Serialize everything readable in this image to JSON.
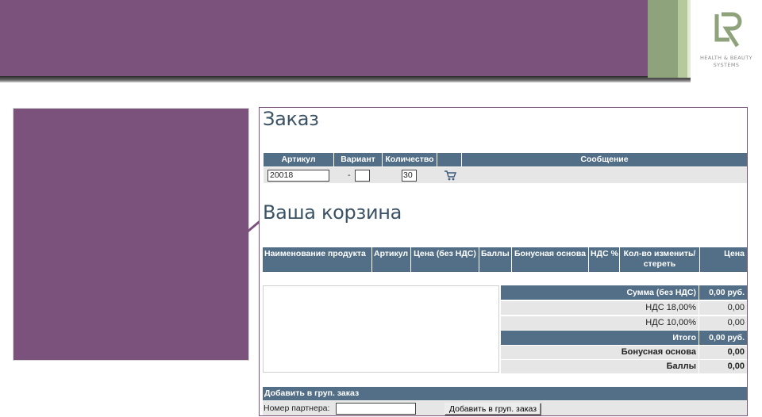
{
  "logo": {
    "letters": "LR",
    "line1": "HEALTH & BEAUTY",
    "line2": "SYSTEMS"
  },
  "order": {
    "title": "Заказ",
    "headers": {
      "article": "Артикул",
      "variant": "Вариант",
      "quantity": "Количество",
      "message": "Сообщение"
    },
    "article_value": "20018",
    "variant_dash": "-",
    "variant_value": "",
    "quantity_value": "30",
    "message_value": "",
    "cart_icon": "cart-icon"
  },
  "basket": {
    "title": "Ваша корзина",
    "headers": {
      "product_name": "Наименование продукта",
      "article": "Артикул",
      "price_no_vat": "Цена (без НДС)",
      "points": "Баллы",
      "bonus_base": "Бонусная основа",
      "vat": "НДС %",
      "qty": "Кол-во изменить/стереть",
      "price": "Цена"
    }
  },
  "summary": {
    "sum_label": "Сумма (без НДС)",
    "sum_value": "0,00 руб.",
    "vat18_label": "НДС 18,00%",
    "vat18_value": "0,00",
    "vat10_label": "НДС 10,00%",
    "vat10_value": "0,00",
    "total_label": "Итого",
    "total_value": "0,00 руб.",
    "bonus_label": "Бонусная основа",
    "bonus_value": "0,00",
    "points_label": "Баллы",
    "points_value": "0,00"
  },
  "group_order": {
    "header": "Добавить в груп. заказ",
    "partner_label": "Номер партнера:",
    "partner_value": "",
    "button_label": "Добавить в груп. заказ"
  },
  "colors": {
    "brand_purple": "#7b527b",
    "header_blue": "#526f87",
    "accent_green": "#8ea27b"
  }
}
